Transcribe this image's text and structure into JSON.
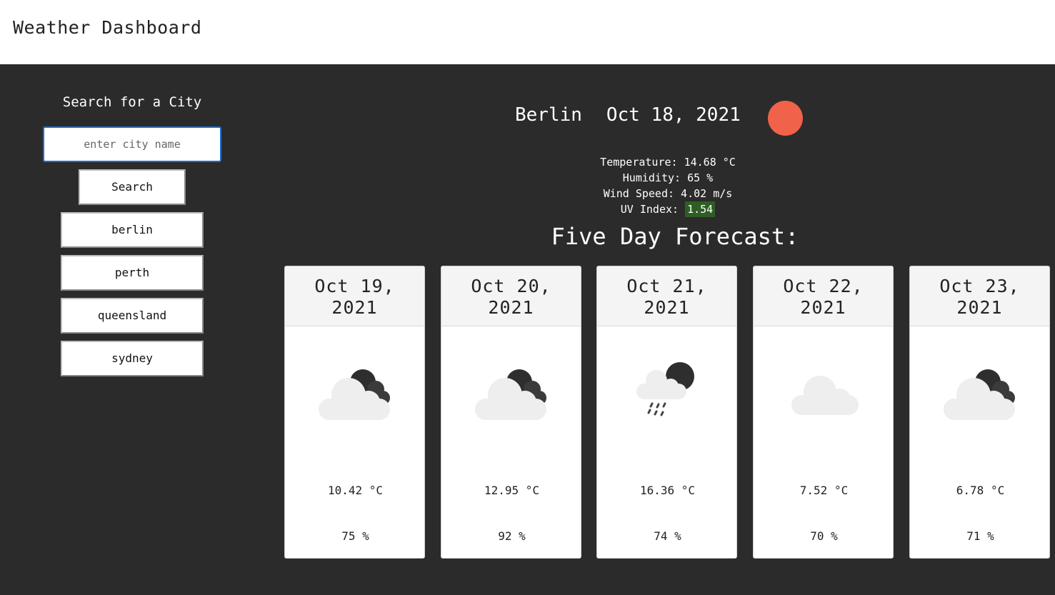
{
  "header": {
    "title": "Weather Dashboard"
  },
  "search": {
    "heading": "Search for a City",
    "placeholder": "enter city name",
    "button_label": "Search"
  },
  "history": [
    "berlin",
    "perth",
    "queensland",
    "sydney"
  ],
  "current": {
    "city": "Berlin",
    "date": "Oct 18, 2021",
    "icon": "clear-sun-icon",
    "icon_color": "#f0624a",
    "temperature": "Temperature: 14.68 °C",
    "humidity": "Humidity: 65 %",
    "wind": "Wind Speed: 4.02 m/s",
    "uv_label": "UV Index:",
    "uv_value": "1.54",
    "uv_color": "#2f5e25"
  },
  "forecast": {
    "title": "Five Day Forecast:",
    "days": [
      {
        "date_line1": "Oct 19,",
        "date_line2": "2021",
        "icon": "cloud-moon-icon",
        "temp": "10.42 °C",
        "humidity": "75 %"
      },
      {
        "date_line1": "Oct 20,",
        "date_line2": "2021",
        "icon": "cloud-moon-icon",
        "temp": "12.95 °C",
        "humidity": "92 %"
      },
      {
        "date_line1": "Oct 21,",
        "date_line2": "2021",
        "icon": "rain-cloud-moon-icon",
        "temp": "16.36 °C",
        "humidity": "74 %"
      },
      {
        "date_line1": "Oct 22,",
        "date_line2": "2021",
        "icon": "cloud-icon",
        "temp": "7.52 °C",
        "humidity": "70 %"
      },
      {
        "date_line1": "Oct 23,",
        "date_line2": "2021",
        "icon": "cloud-moon-icon",
        "temp": "6.78 °C",
        "humidity": "71 %"
      }
    ]
  }
}
